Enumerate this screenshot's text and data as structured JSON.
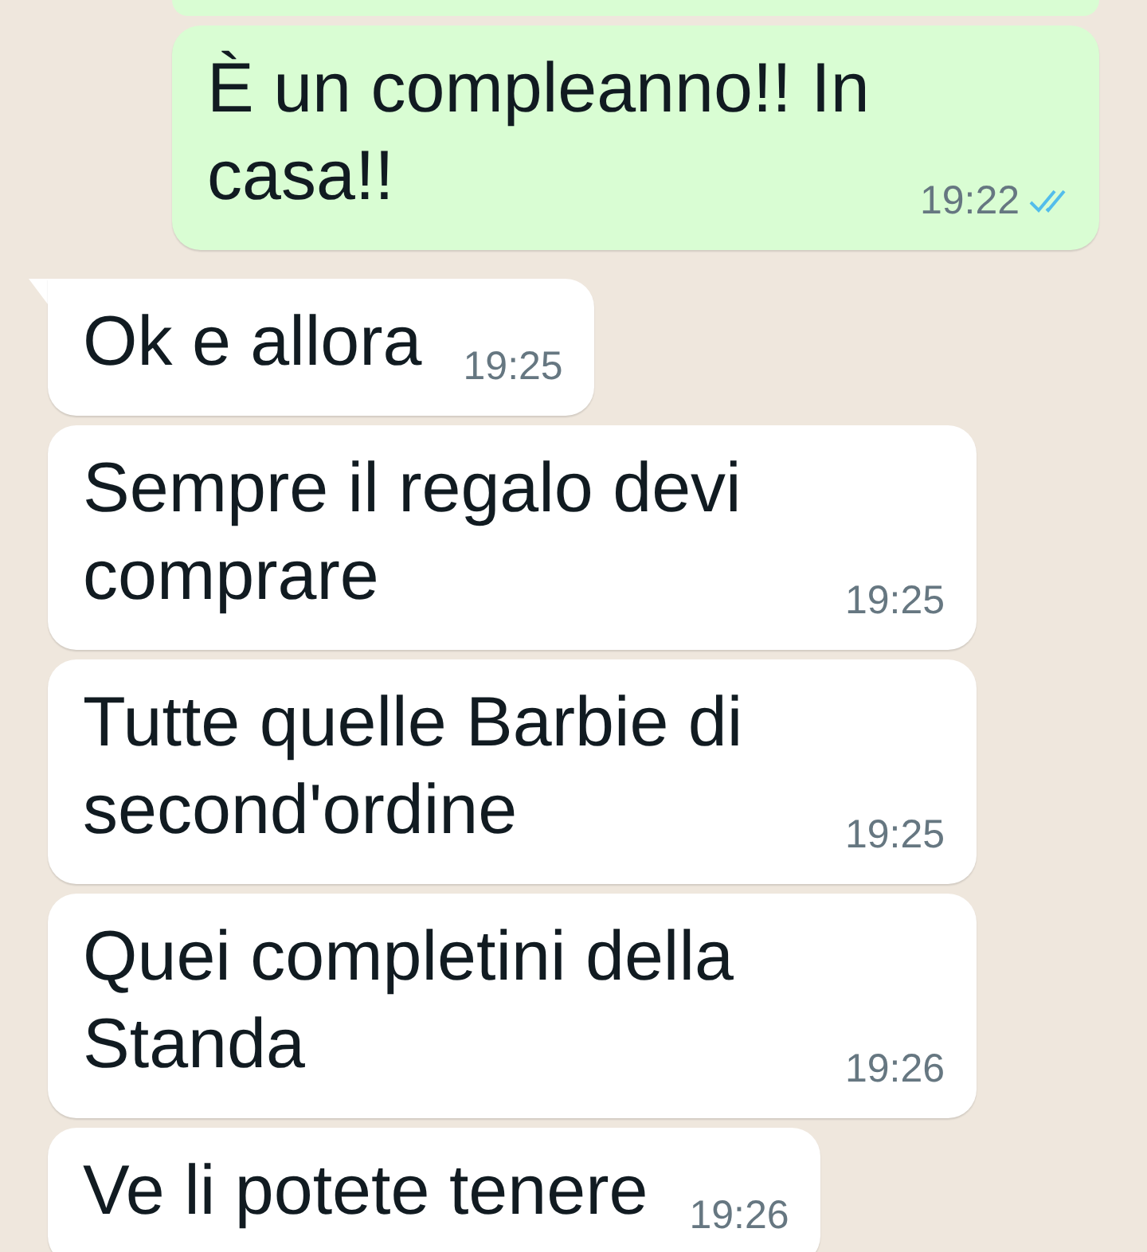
{
  "messages": [
    {
      "kind": "outgoing",
      "cut": true
    },
    {
      "kind": "outgoing",
      "text": "È un compleanno!! In casa!!",
      "time": "19:22",
      "read": true
    },
    {
      "kind": "incoming",
      "tail": true,
      "text": "Ok e allora",
      "time": "19:25"
    },
    {
      "kind": "incoming",
      "text": "Sempre il regalo devi comprare",
      "time": "19:25"
    },
    {
      "kind": "incoming",
      "text": "Tutte quelle Barbie di second'ordine",
      "time": "19:25"
    },
    {
      "kind": "incoming",
      "text": "Quei completini della Standa",
      "time": "19:26"
    },
    {
      "kind": "incoming",
      "text": "Ve li potete tenere",
      "time": "19:26"
    }
  ]
}
